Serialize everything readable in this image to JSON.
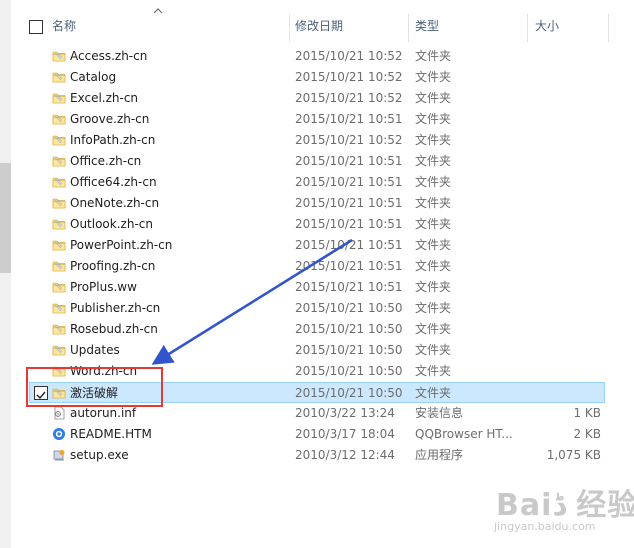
{
  "header": {
    "name_label": "名称",
    "date_label": "修改日期",
    "type_label": "类型",
    "size_label": "大小"
  },
  "rows": [
    {
      "name": "Access.zh-cn",
      "date": "2015/10/21 10:52",
      "type": "文件夹",
      "size": "",
      "icon": "folder-icon"
    },
    {
      "name": "Catalog",
      "date": "2015/10/21 10:52",
      "type": "文件夹",
      "size": "",
      "icon": "folder-icon"
    },
    {
      "name": "Excel.zh-cn",
      "date": "2015/10/21 10:52",
      "type": "文件夹",
      "size": "",
      "icon": "folder-icon"
    },
    {
      "name": "Groove.zh-cn",
      "date": "2015/10/21 10:51",
      "type": "文件夹",
      "size": "",
      "icon": "folder-icon"
    },
    {
      "name": "InfoPath.zh-cn",
      "date": "2015/10/21 10:52",
      "type": "文件夹",
      "size": "",
      "icon": "folder-icon"
    },
    {
      "name": "Office.zh-cn",
      "date": "2015/10/21 10:51",
      "type": "文件夹",
      "size": "",
      "icon": "folder-icon"
    },
    {
      "name": "Office64.zh-cn",
      "date": "2015/10/21 10:51",
      "type": "文件夹",
      "size": "",
      "icon": "folder-icon"
    },
    {
      "name": "OneNote.zh-cn",
      "date": "2015/10/21 10:51",
      "type": "文件夹",
      "size": "",
      "icon": "folder-icon"
    },
    {
      "name": "Outlook.zh-cn",
      "date": "2015/10/21 10:51",
      "type": "文件夹",
      "size": "",
      "icon": "folder-icon"
    },
    {
      "name": "PowerPoint.zh-cn",
      "date": "2015/10/21 10:51",
      "type": "文件夹",
      "size": "",
      "icon": "folder-icon"
    },
    {
      "name": "Proofing.zh-cn",
      "date": "2015/10/21 10:51",
      "type": "文件夹",
      "size": "",
      "icon": "folder-icon"
    },
    {
      "name": "ProPlus.ww",
      "date": "2015/10/21 10:51",
      "type": "文件夹",
      "size": "",
      "icon": "folder-icon"
    },
    {
      "name": "Publisher.zh-cn",
      "date": "2015/10/21 10:50",
      "type": "文件夹",
      "size": "",
      "icon": "folder-icon"
    },
    {
      "name": "Rosebud.zh-cn",
      "date": "2015/10/21 10:50",
      "type": "文件夹",
      "size": "",
      "icon": "folder-icon"
    },
    {
      "name": "Updates",
      "date": "2015/10/21 10:50",
      "type": "文件夹",
      "size": "",
      "icon": "folder-icon"
    },
    {
      "name": "Word.zh-cn",
      "date": "2015/10/21 10:50",
      "type": "文件夹",
      "size": "",
      "icon": "folder-icon"
    },
    {
      "name": "激活破解",
      "date": "2015/10/21 10:50",
      "type": "文件夹",
      "size": "",
      "icon": "folder-icon",
      "selected": true
    },
    {
      "name": "autorun.inf",
      "date": "2010/3/22 13:24",
      "type": "安装信息",
      "size": "1 KB",
      "icon": "inf-file-icon"
    },
    {
      "name": "README.HTM",
      "date": "2010/3/17 18:04",
      "type": "QQBrowser HT...",
      "size": "2 KB",
      "icon": "browser-file-icon"
    },
    {
      "name": "setup.exe",
      "date": "2010/3/12 12:44",
      "type": "应用程序",
      "size": "1,075 KB",
      "icon": "setup-exe-icon"
    }
  ],
  "watermark": {
    "main": "Baiڈ 经验",
    "sub": "jingyan.baidu.com"
  },
  "colors": {
    "selection_bg": "#cce8ff",
    "selection_border": "#99d1ff",
    "callout_red": "#e53935",
    "arrow_blue": "#3355cc",
    "folder_yellow": "#e8c35a"
  }
}
